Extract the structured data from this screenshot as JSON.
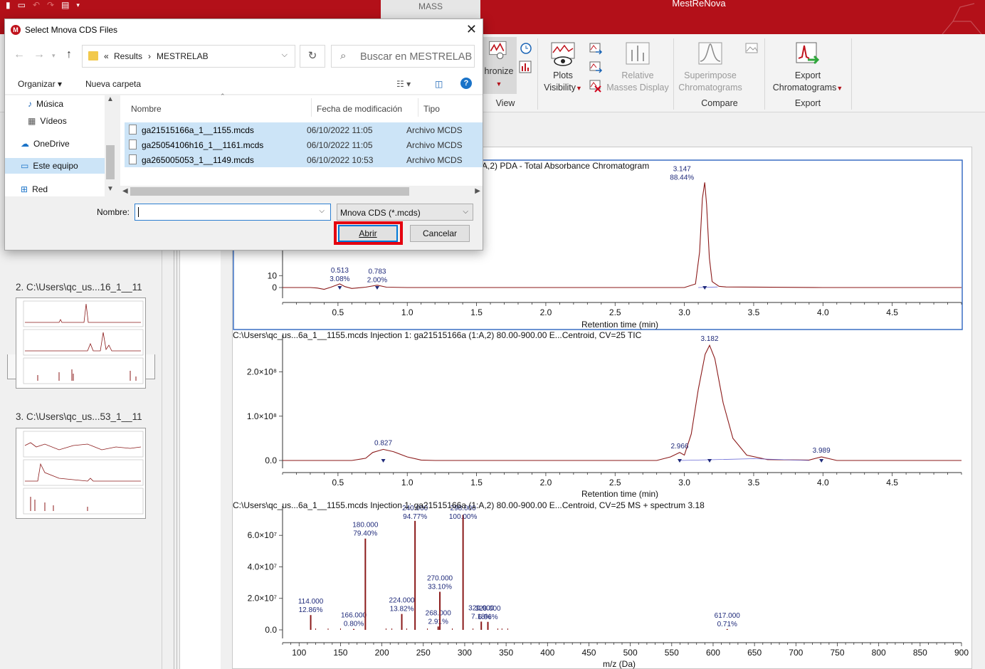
{
  "app": {
    "title": "MestReNova",
    "mass_tab": "MASS"
  },
  "ribbon": {
    "sync_label": "hronize",
    "view_label": "View",
    "plots_label": "Plots",
    "visibility_label": "Visibility",
    "relative_label": "Relative",
    "masses_display_label": "Masses Display",
    "superimpose_label": "Superimpose",
    "chromatograms_label": "Chromatograms",
    "compare_label": "Compare",
    "export_label": "Export",
    "export_chroms_label": "Chromatograms",
    "export_group_label": "Export"
  },
  "left_panel": {
    "items": [
      {
        "title": "2. C:\\Users\\qc_us...16_1__11"
      },
      {
        "title": "3. C:\\Users\\qc_us...53_1__11"
      }
    ]
  },
  "dialog": {
    "title": "Select Mnova CDS Files",
    "breadcrumb": {
      "prefix": "«",
      "parent": "Results",
      "sep": "›",
      "current": "MESTRELAB"
    },
    "search_placeholder": "Buscar en MESTRELAB",
    "organize_label": "Organizar",
    "new_folder_label": "Nueva carpeta",
    "nav_tree": [
      {
        "label": "Música",
        "icon": "music-icon"
      },
      {
        "label": "Vídeos",
        "icon": "video-icon"
      },
      {
        "label": "OneDrive",
        "icon": "cloud-icon"
      },
      {
        "label": "Este equipo",
        "icon": "computer-icon"
      },
      {
        "label": "Red",
        "icon": "network-icon"
      }
    ],
    "columns": {
      "name": "Nombre",
      "date": "Fecha de modificación",
      "type": "Tipo"
    },
    "files": [
      {
        "name": "ga21515166a_1__1155.mcds",
        "date": "06/10/2022 11:05",
        "type": "Archivo MCDS"
      },
      {
        "name": "ga25054106h16_1__1161.mcds",
        "date": "06/10/2022 11:05",
        "type": "Archivo MCDS"
      },
      {
        "name": "ga265005053_1__1149.mcds",
        "date": "06/10/2022 10:53",
        "type": "Archivo MCDS"
      }
    ],
    "filename_label": "Nombre:",
    "filename_value": "",
    "filter_value": "Mnova CDS (*.mcds)",
    "open_label": "Abrir",
    "cancel_label": "Cancelar"
  },
  "plots": {
    "p1_title": "A,2)  PDA - Total Absorbance Chromatogram",
    "p1_xlabel": "Retention time (min)",
    "p2_title": "C:\\Users\\qc_us...6a_1__1155.mcds Injection 1: ga21515166a (1:A,2) 80.00-900.00 E...Centroid, CV=25 TIC",
    "p2_xlabel": "Retention time (min)",
    "p3_title": "C:\\Users\\qc_us...6a_1__1155.mcds Injection 1: ga21515166a (1:A,2) 80.00-900.00 E...Centroid, CV=25 MS + spectrum 3.18",
    "p3_xlabel": "m/z (Da)"
  },
  "chart_data": [
    {
      "type": "line",
      "title": "PDA - Total Absorbance Chromatogram",
      "xlabel": "Retention time (min)",
      "xlim": [
        0.1,
        5.0
      ],
      "xticks": [
        0.5,
        1.0,
        1.5,
        2.0,
        2.5,
        3.0,
        3.5,
        4.0,
        4.5
      ],
      "yticks": [
        0,
        10
      ],
      "ylim": [
        0,
        100
      ],
      "series": [
        {
          "x": [
            0.1,
            0.3,
            0.35,
            0.4,
            0.45,
            0.513,
            0.55,
            0.6,
            0.7,
            0.783,
            0.85,
            1.0,
            2.0,
            3.0,
            3.08,
            3.11,
            3.13,
            3.147,
            3.16,
            3.18,
            3.2,
            3.25,
            3.3,
            4.0,
            5.0
          ],
          "y": [
            0,
            0,
            -0.4,
            -1.5,
            0.3,
            3.08,
            0.8,
            -0.8,
            0.3,
            2.0,
            0.3,
            0,
            0,
            0,
            3,
            30,
            75,
            88.44,
            70,
            25,
            5,
            1,
            0.5,
            0,
            0
          ]
        }
      ],
      "peak_labels": [
        {
          "x": 3.147,
          "y": 88.44,
          "rt": "3.147",
          "pct": "88.44%"
        },
        {
          "x": 0.513,
          "y": 3.08,
          "rt": "0.513",
          "pct": "3.08%"
        },
        {
          "x": 0.783,
          "y": 2.0,
          "rt": "0.783",
          "pct": "2.00%"
        }
      ]
    },
    {
      "type": "line",
      "title": "TIC",
      "xlabel": "Retention time (min)",
      "xlim": [
        0.1,
        5.0
      ],
      "xticks": [
        0.5,
        1.0,
        1.5,
        2.0,
        2.5,
        3.0,
        3.5,
        4.0,
        4.5
      ],
      "yticks_labels": [
        "0.0",
        "1.0×10⁸",
        "2.0×10⁸"
      ],
      "yticks": [
        0,
        100000000.0,
        200000000.0
      ],
      "ylim": [
        0,
        270000000.0
      ],
      "series": [
        {
          "x": [
            0.1,
            0.6,
            0.7,
            0.75,
            0.827,
            0.9,
            1.0,
            1.1,
            1.2,
            2.8,
            2.9,
            2.966,
            3.0,
            3.05,
            3.1,
            3.15,
            3.182,
            3.22,
            3.28,
            3.35,
            3.45,
            3.6,
            3.9,
            3.989,
            4.1,
            5.0
          ],
          "y": [
            0,
            0,
            5000000.0,
            18000000.0,
            25000000.0,
            20000000.0,
            8000000.0,
            1000000.0,
            0,
            0,
            8000000.0,
            18000000.0,
            12000000.0,
            60000000.0,
            160000000.0,
            240000000.0,
            260000000.0,
            230000000.0,
            130000000.0,
            50000000.0,
            12000000.0,
            2000000.0,
            1000000.0,
            8000000.0,
            0,
            0
          ]
        }
      ],
      "peak_labels": [
        {
          "x": 3.182,
          "y": 260000000.0,
          "rt": "3.182"
        },
        {
          "x": 0.827,
          "y": 25000000.0,
          "rt": "0.827"
        },
        {
          "x": 2.966,
          "y": 18000000.0,
          "rt": "2.966"
        },
        {
          "x": 3.989,
          "y": 8000000.0,
          "rt": "3.989"
        }
      ]
    },
    {
      "type": "bar",
      "title": "MS + spectrum 3.18",
      "xlabel": "m/z (Da)",
      "xlim": [
        80,
        900
      ],
      "xticks": [
        100,
        150,
        200,
        250,
        300,
        350,
        400,
        450,
        500,
        550,
        600,
        650,
        700,
        750,
        800,
        850,
        900
      ],
      "yticks_labels": [
        "0.0",
        "2.0×10⁷",
        "4.0×10⁷",
        "6.0×10⁷"
      ],
      "yticks": [
        0,
        20000000.0,
        40000000.0,
        60000000.0
      ],
      "ylim": [
        0,
        75000000.0
      ],
      "peaks": [
        {
          "mz": 114.0,
          "pct": 12.86,
          "label": "114.000",
          "pct_label": "12.86%"
        },
        {
          "mz": 166.0,
          "pct": 0.8,
          "label": "166.000",
          "pct_label": "0.80%"
        },
        {
          "mz": 180.0,
          "pct": 79.4,
          "label": "180.000",
          "pct_label": "79.40%"
        },
        {
          "mz": 224.0,
          "pct": 13.82,
          "label": "224.000",
          "pct_label": "13.82%"
        },
        {
          "mz": 240.0,
          "pct": 94.77,
          "label": "240.000",
          "pct_label": "94.77%"
        },
        {
          "mz": 268.0,
          "pct": 2.91,
          "label": "268.000",
          "pct_label": "2.91%"
        },
        {
          "mz": 270.0,
          "pct": 33.1,
          "label": "270.000",
          "pct_label": "33.10%"
        },
        {
          "mz": 298.0,
          "pct": 100.0,
          "label": "298.000",
          "pct_label": "100.00%"
        },
        {
          "mz": 320.0,
          "pct": 7.18,
          "label": "320.000",
          "pct_label": "7.18%"
        },
        {
          "mz": 328.0,
          "pct": 6.96,
          "label": "328.000",
          "pct_label": "6.96%"
        },
        {
          "mz": 617.0,
          "pct": 0.71,
          "label": "617.000",
          "pct_label": "0.71%"
        }
      ],
      "base_intensity": 73000000.0
    }
  ],
  "colors": {
    "brand_red": "#b31019",
    "trace": "#8b1a1a",
    "label_blue": "#1f2a7a",
    "highlight": "#e4000f",
    "selection": "#cce4f7"
  }
}
